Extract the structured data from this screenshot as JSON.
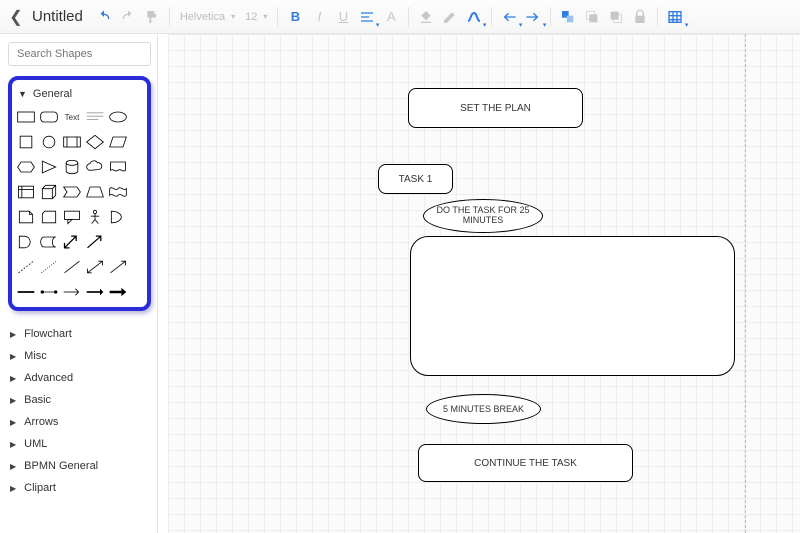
{
  "header": {
    "title": "Untitled",
    "font_name": "Helvetica",
    "font_size": "12"
  },
  "sidebar": {
    "search_placeholder": "Search Shapes",
    "open_section": "General",
    "categories": [
      "Flowchart",
      "Misc",
      "Advanced",
      "Basic",
      "Arrows",
      "UML",
      "BPMN General",
      "Clipart"
    ],
    "general_shape_text": "Text"
  },
  "canvas": {
    "nodes": {
      "set_plan": {
        "label": "SET THE PLAN"
      },
      "task1": {
        "label": "TASK 1"
      },
      "do_task": {
        "label": "DO THE TASK FOR 25 MINUTES"
      },
      "big_box": {
        "label": ""
      },
      "break5": {
        "label": "5 MINUTES BREAK"
      },
      "continue": {
        "label": "CONTINUE THE TASK"
      }
    }
  }
}
